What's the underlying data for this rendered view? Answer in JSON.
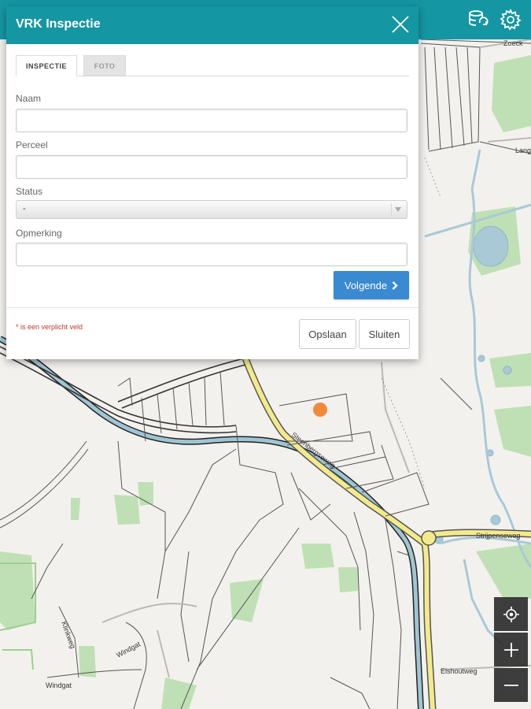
{
  "dialog": {
    "title": "VRK Inspectie",
    "tabs": [
      {
        "label": "INSPECTIE",
        "active": true
      },
      {
        "label": "FOTO",
        "active": false
      }
    ],
    "fields": {
      "naam": {
        "label": "Naam",
        "value": ""
      },
      "perceel": {
        "label": "Perceel",
        "value": ""
      },
      "status": {
        "label": "Status",
        "value": "-"
      },
      "opmerking": {
        "label": "Opmerking",
        "value": ""
      }
    },
    "next_label": "Volgende",
    "required_note": "* is een verplicht veld",
    "save_label": "Opslaan",
    "close_label": "Sluiten"
  },
  "map": {
    "street_labels": [
      "Zoeck",
      "Lang",
      "Steenbergseweg",
      "Strijpenseweg",
      "Klinkweg",
      "Windgat",
      "Windgat",
      "Elshoutweg"
    ]
  },
  "toolbar_icons": [
    "database-sync-icon",
    "gear-icon"
  ],
  "map_controls": [
    "locate-icon",
    "zoom-in-icon",
    "zoom-out-icon"
  ],
  "colors": {
    "header": "#1596a3",
    "primary_button": "#3a8ad1",
    "required_text": "#c0392b",
    "road_main": "#f3ea8c",
    "water": "#a9c9d6",
    "green": "#b9dcae",
    "marker": "#f08a3a"
  }
}
